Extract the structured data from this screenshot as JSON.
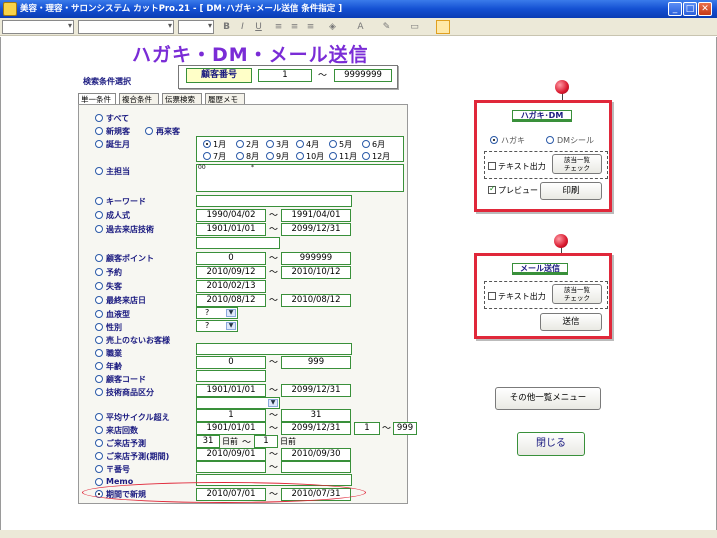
{
  "window": {
    "title": "美容・理容・サロンシステム カットPro.21 - [ DM･ハガキ･メール送信 条件指定 ]",
    "min": "_",
    "max": "□",
    "close": "✕"
  },
  "toolbar": {
    "bold": "B",
    "italic": "I",
    "underline": "U"
  },
  "heading": "ハガキ・DM・メール送信",
  "search_label": "検索条件選択",
  "customer_range": {
    "label": "顧客番号",
    "from": "1",
    "to": "9999999"
  },
  "tabs": [
    "単一条件",
    "複合条件",
    "伝票検索",
    "履歴メモ"
  ],
  "tilde": "〜",
  "conditions": {
    "all": "すべて",
    "new": "新規客",
    "repeat": "再来客",
    "birth_month": "誕生月",
    "months": [
      "1月",
      "2月",
      "3月",
      "4月",
      "5月",
      "6月",
      "7月",
      "8月",
      "9月",
      "10月",
      "11月",
      "12月"
    ],
    "main_staff": "主担当",
    "memo_a": "00",
    "memo_b": "*",
    "keyword": "キーワード",
    "coming_of_age": "成人式",
    "coa_from": "1990/04/02",
    "coa_to": "1991/04/01",
    "past_tech": "過去来店技術",
    "pt_from": "1901/01/01",
    "pt_to": "2099/12/31",
    "points": "顧客ポイント",
    "pts_from": "0",
    "pts_to": "999999",
    "reservation": "予約",
    "res_from": "2010/09/12",
    "res_to": "2010/10/12",
    "lost": "失客",
    "lost_date": "2010/02/13",
    "last_visit": "最終来店日",
    "lv_from": "2010/08/12",
    "lv_to": "2010/08/12",
    "blood": "血液型",
    "blood_val": "?",
    "sex": "性別",
    "sex_val": "?",
    "no_sales": "売上のないお客様",
    "occupation": "職業",
    "age": "年齢",
    "age_from": "0",
    "age_to": "999",
    "cust_code": "顧客コード",
    "tech_item": "技術商品区分",
    "ti_from": "1901/01/01",
    "ti_to": "2099/12/31",
    "avg_cycle": "平均サイクル超え",
    "ac_from": "1",
    "ac_to": "31",
    "visit_count": "来店回数",
    "vc_from": "1901/01/01",
    "vc_to": "2099/12/31",
    "vc_n_from": "1",
    "vc_n_to": "999",
    "forecast": "ご来店予測",
    "fc_days": "31",
    "days_label": "日前",
    "fc_days2": "1",
    "days_label2": "日前",
    "forecast_period": "ご来店予測(期間)",
    "fp_from": "2010/09/01",
    "fp_to": "2010/09/30",
    "postal": "〒番号",
    "memo": "Memo",
    "new_period": "期間で新規",
    "np_from": "2010/07/01",
    "np_to": "2010/07/31"
  },
  "card_mail": {
    "title": "ハガキ･DM",
    "postcard": "ハガキ",
    "dm_seal": "DMシール",
    "text_out": "テキスト出力",
    "list_check": "該当一覧\nチェック",
    "preview": "プレビュー",
    "print": "印刷"
  },
  "card_email": {
    "title": "メール送信",
    "text_out": "テキスト出力",
    "list_check": "該当一覧\nチェック",
    "send": "送信"
  },
  "other_menu": "その他一覧メニュー",
  "close_button": "閉じる"
}
